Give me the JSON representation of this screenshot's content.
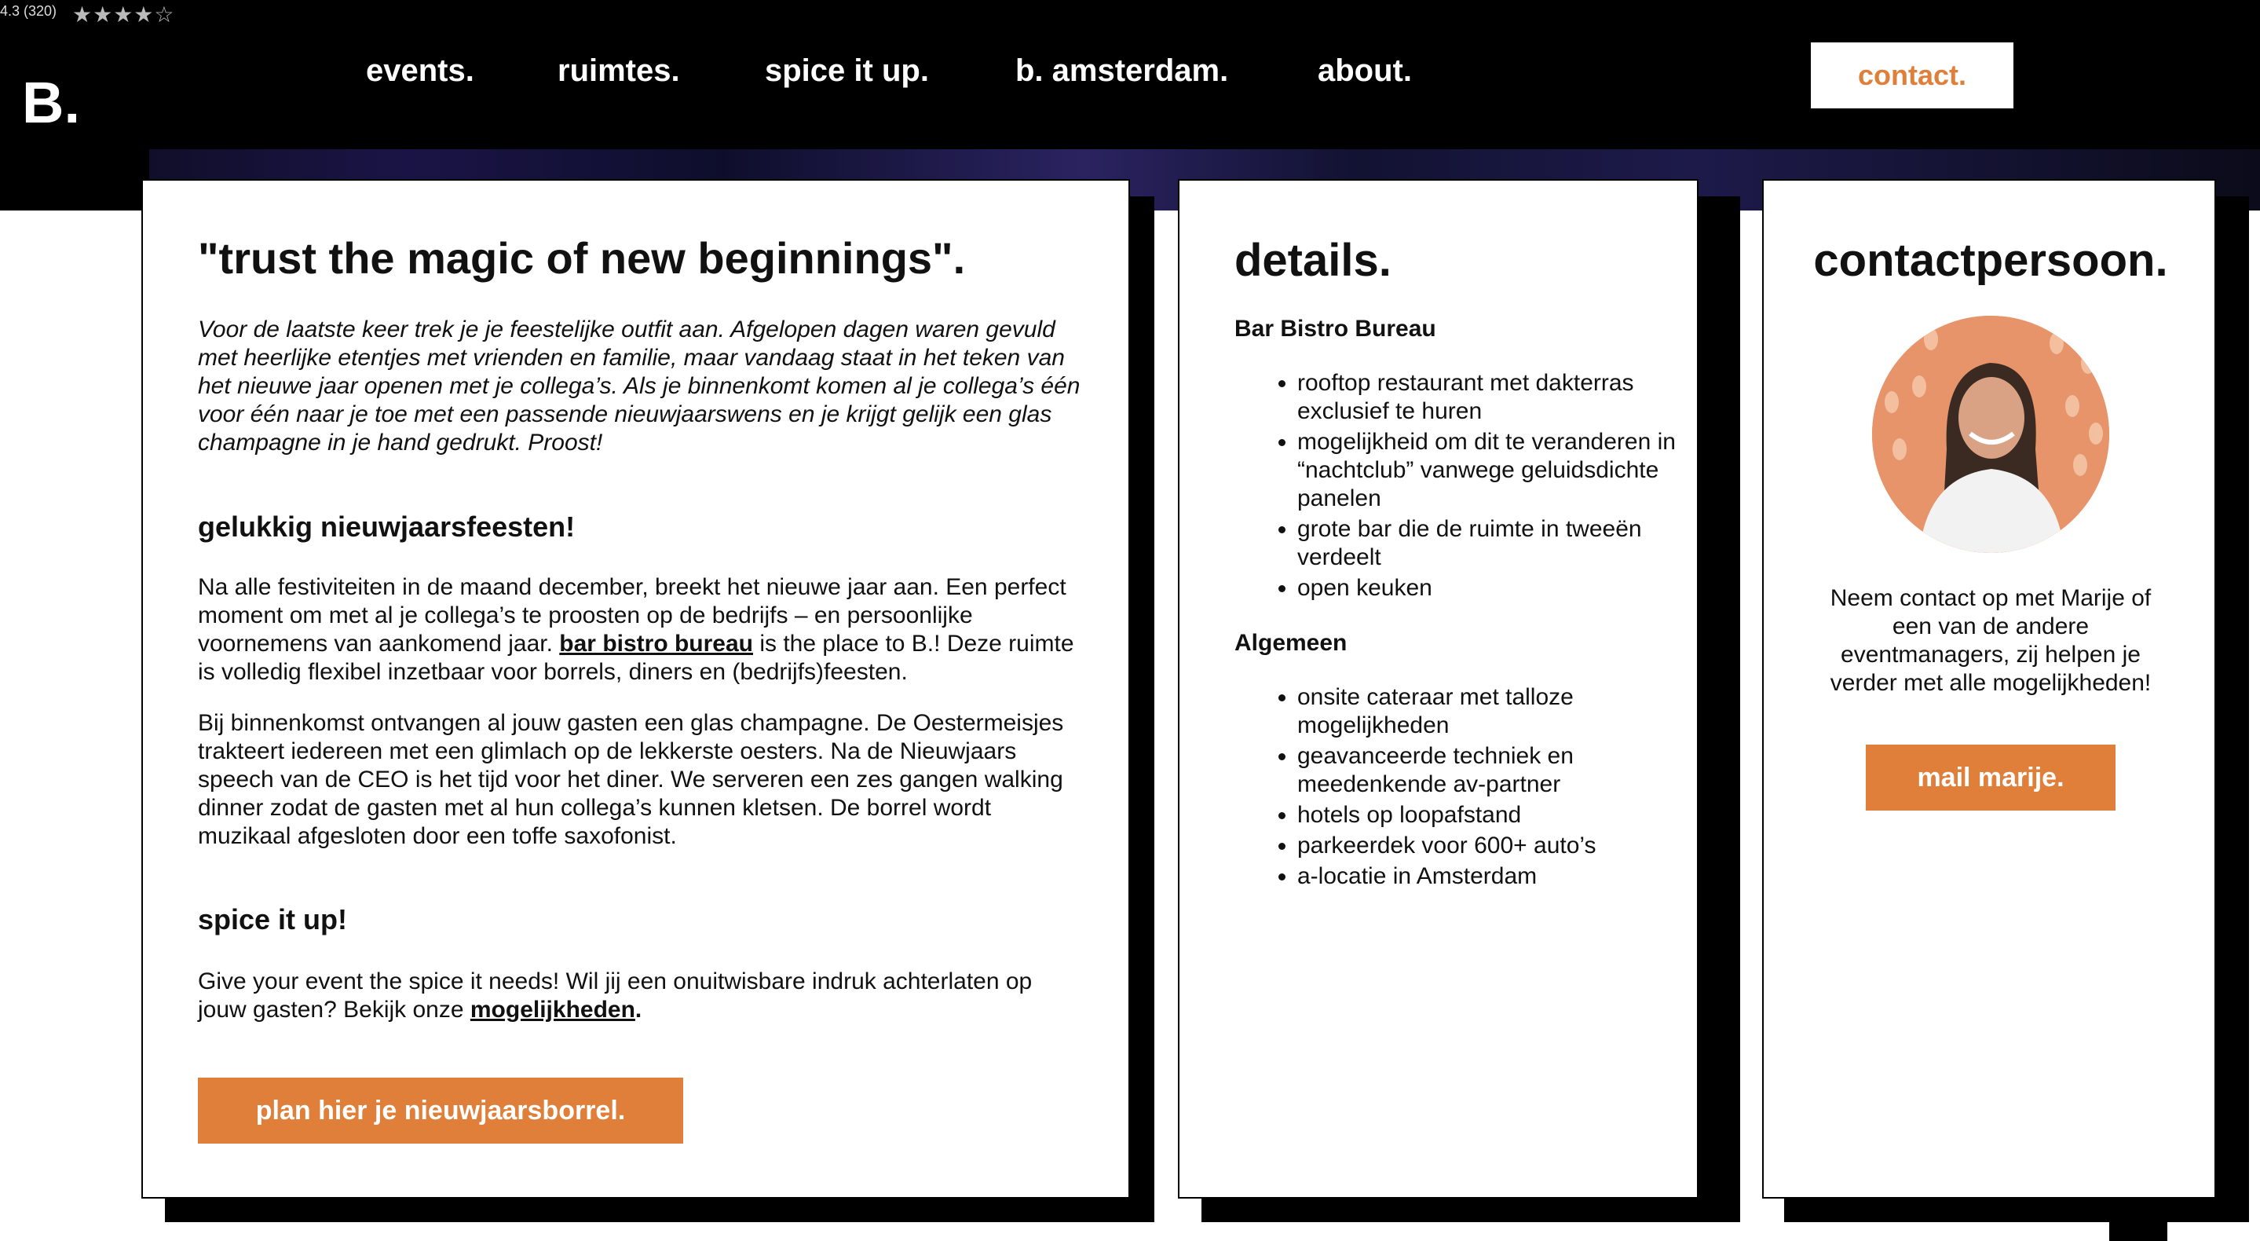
{
  "rating": {
    "text": "4.3 (320)",
    "stars": "★★★★☆"
  },
  "logo": "B.",
  "nav": {
    "items": [
      "events.",
      "ruimtes.",
      "spice it up.",
      "b. amsterdam.",
      "about."
    ],
    "contact": "contact."
  },
  "colors": {
    "accent": "#e07f3a",
    "topbar": "#000000"
  },
  "main": {
    "title": "\"trust the magic of new beginnings\".",
    "intro": "Voor de laatste keer trek je je feestelijke outfit aan. Afgelopen dagen waren gevuld met heerlijke etentjes met vrienden en familie, maar vandaag staat in het teken van het nieuwe jaar openen met je collega’s. Als je binnenkomt komen al je collega’s één voor één naar je toe met een passende nieuwjaarswens en je krijgt gelijk een glas champagne in je hand gedrukt. Proost!",
    "h2_1": "gelukkig nieuwjaarsfeesten!",
    "p1_before": "Na alle festiviteiten in de maand december, breekt het nieuwe jaar aan. Een perfect moment om met al je collega’s te proosten op de bedrijfs – en persoonlijke voornemens van aankomend jaar. ",
    "p1_link": "bar bistro bureau",
    "p1_after": " is the place to B.! Deze ruimte is volledig flexibel inzetbaar voor borrels, diners en (bedrijfs)feesten.",
    "p2": "Bij binnenkomst ontvangen al jouw gasten een glas champagne. De Oestermeisjes trakteert iedereen met een glimlach op de lekkerste oesters. Na de Nieuwjaars speech van de CEO is het tijd voor het diner. We serveren een zes gangen walking dinner zodat de gasten met al hun collega’s kunnen kletsen. De borrel wordt muzikaal afgesloten door een toffe saxofonist.",
    "h2_2": "spice it up!",
    "p3_before": "Give your event the spice it needs! Wil jij een onuitwisbare indruk achterlaten op jouw gasten? Bekijk onze ",
    "p3_link": "mogelijkheden",
    "p3_after": ".",
    "cta": "plan hier je nieuwjaarsborrel."
  },
  "details": {
    "title": "details.",
    "section1_label": "Bar Bistro Bureau",
    "section1_items": [
      "rooftop restaurant met dakterras exclusief te huren",
      "mogelijkheid om dit te veranderen in “nachtclub” vanwege geluidsdichte panelen",
      "grote bar die de ruimte in tweeën verdeelt",
      "open keuken"
    ],
    "section2_label": "Algemeen",
    "section2_items": [
      "onsite cateraar met talloze mogelijkheden",
      "geavanceerde techniek en meedenkende av-partner",
      "hotels op loopafstand",
      "parkeerdek voor 600+ auto’s",
      "a-locatie in Amsterdam"
    ]
  },
  "contact": {
    "title": "contactpersoon.",
    "text": "Neem contact op met Marije of een van de andere eventmanagers, zij helpen je verder met alle mogelijkheden!",
    "button": "mail marije."
  }
}
